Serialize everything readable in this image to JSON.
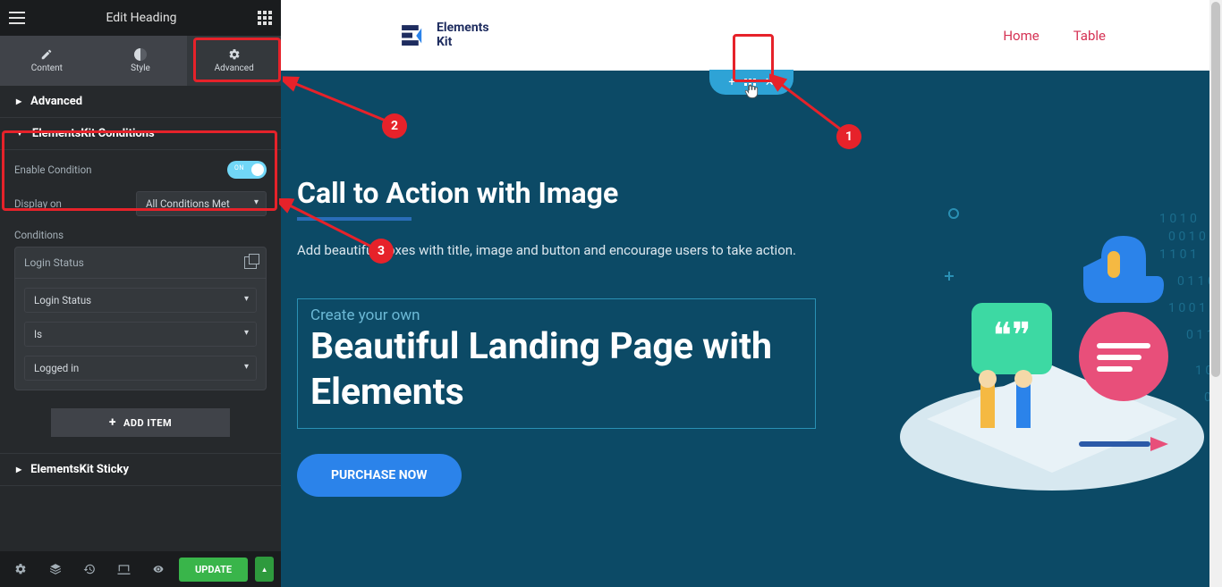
{
  "sidebar": {
    "title": "Edit Heading",
    "tabs": {
      "content": "Content",
      "style": "Style",
      "advanced": "Advanced"
    },
    "sections": {
      "advanced": "Advanced",
      "conditions": "ElementsKit Conditions",
      "sticky": "ElementsKit Sticky"
    },
    "enable_condition_label": "Enable Condition",
    "toggle_text": "ON",
    "display_on_label": "Display on",
    "display_on_value": "All Conditions Met",
    "conditions_label": "Conditions",
    "card_title": "Login Status",
    "cond_field1": "Login Status",
    "cond_field2": "Is",
    "cond_field3": "Logged in",
    "add_item": "ADD ITEM",
    "update": "UPDATE"
  },
  "page": {
    "logo_top": "Elements",
    "logo_bottom": "Kit",
    "nav": {
      "home": "Home",
      "table": "Table"
    },
    "hero_title": "Call to Action with Image",
    "hero_sub": "Add beautiful boxes with title, image and button and encourage users to take action.",
    "cta_top": "Create your own",
    "cta_title": "Beautiful Landing Page with Elements",
    "buy": "PURCHASE NOW"
  },
  "annotations": {
    "n1": "1",
    "n2": "2",
    "n3": "3"
  }
}
